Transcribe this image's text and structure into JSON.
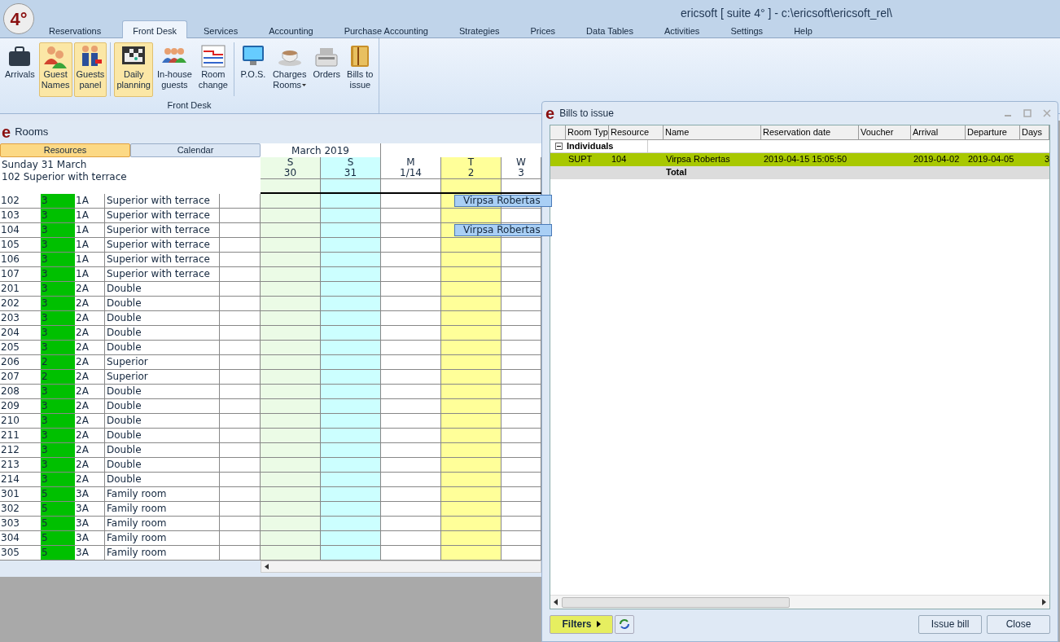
{
  "app": {
    "logo": "4°",
    "title": "ericsoft [ suite 4° ] - c:\\ericsoft\\ericsoft_rel\\"
  },
  "tabs": [
    {
      "label": "Reservations",
      "selected": false
    },
    {
      "label": "Front Desk",
      "selected": true
    },
    {
      "label": "Services",
      "selected": false
    },
    {
      "label": "Accounting",
      "selected": false
    },
    {
      "label": "Purchase Accounting",
      "selected": false
    },
    {
      "label": "Strategies",
      "selected": false
    },
    {
      "label": "Prices",
      "selected": false
    },
    {
      "label": "Data Tables",
      "selected": false
    },
    {
      "label": "Activities",
      "selected": false
    },
    {
      "label": "Settings",
      "selected": false
    },
    {
      "label": "Help",
      "selected": false
    }
  ],
  "ribbon": {
    "group_label": "Front Desk",
    "items": [
      {
        "lines": [
          "Arrivals"
        ],
        "active": false,
        "dropdown": false,
        "separator_before": false
      },
      {
        "lines": [
          "Guest",
          "Names"
        ],
        "active": true,
        "dropdown": false,
        "separator_before": false
      },
      {
        "lines": [
          "Guests",
          "panel"
        ],
        "active": true,
        "dropdown": false,
        "separator_before": false
      },
      {
        "lines": [
          "Daily",
          "planning"
        ],
        "active": true,
        "dropdown": false,
        "separator_before": true
      },
      {
        "lines": [
          "In-house",
          "guests"
        ],
        "active": false,
        "dropdown": false,
        "separator_before": false
      },
      {
        "lines": [
          "Room",
          "change"
        ],
        "active": false,
        "dropdown": false,
        "separator_before": false
      },
      {
        "lines": [
          "P.O.S."
        ],
        "active": false,
        "dropdown": false,
        "separator_before": true
      },
      {
        "lines": [
          "Charges",
          "Rooms"
        ],
        "active": false,
        "dropdown": true,
        "separator_before": false
      },
      {
        "lines": [
          "Orders"
        ],
        "active": false,
        "dropdown": false,
        "separator_before": false
      },
      {
        "lines": [
          "Bills to",
          "issue"
        ],
        "active": false,
        "dropdown": false,
        "separator_before": false
      }
    ]
  },
  "rooms": {
    "logo": "e",
    "title": "Rooms",
    "view_tabs": [
      {
        "label": "Resources",
        "selected": true
      },
      {
        "label": "Calendar",
        "selected": false
      }
    ],
    "date_line": "Sunday 31 March",
    "room_line": "102 Superior with terrace",
    "month": "March 2019",
    "days": [
      {
        "weekday": "S",
        "day": "30",
        "color": "#ebfbe6"
      },
      {
        "weekday": "S",
        "day": "31",
        "color": "#ccffff"
      },
      {
        "weekday": "M",
        "day": "1/14",
        "color": "#ffffff"
      },
      {
        "weekday": "T",
        "day": "2",
        "color": "#ffff99"
      },
      {
        "weekday": "W",
        "day": "3",
        "color": "#ffffff"
      }
    ],
    "rows": [
      {
        "room": "102",
        "capacity": "3",
        "code": "1A",
        "type": "Superior with terrace",
        "booking": "Virpsa Robertas"
      },
      {
        "room": "103",
        "capacity": "3",
        "code": "1A",
        "type": "Superior with terrace"
      },
      {
        "room": "104",
        "capacity": "3",
        "code": "1A",
        "type": "Superior with terrace",
        "booking": "Virpsa Robertas"
      },
      {
        "room": "105",
        "capacity": "3",
        "code": "1A",
        "type": "Superior with terrace"
      },
      {
        "room": "106",
        "capacity": "3",
        "code": "1A",
        "type": "Superior with terrace"
      },
      {
        "room": "107",
        "capacity": "3",
        "code": "1A",
        "type": "Superior with terrace"
      },
      {
        "room": "201",
        "capacity": "3",
        "code": "2A",
        "type": "Double"
      },
      {
        "room": "202",
        "capacity": "3",
        "code": "2A",
        "type": "Double"
      },
      {
        "room": "203",
        "capacity": "3",
        "code": "2A",
        "type": "Double"
      },
      {
        "room": "204",
        "capacity": "3",
        "code": "2A",
        "type": "Double"
      },
      {
        "room": "205",
        "capacity": "3",
        "code": "2A",
        "type": "Double"
      },
      {
        "room": "206",
        "capacity": "2",
        "code": "2A",
        "type": "Superior"
      },
      {
        "room": "207",
        "capacity": "2",
        "code": "2A",
        "type": "Superior"
      },
      {
        "room": "208",
        "capacity": "3",
        "code": "2A",
        "type": "Double"
      },
      {
        "room": "209",
        "capacity": "3",
        "code": "2A",
        "type": "Double"
      },
      {
        "room": "210",
        "capacity": "3",
        "code": "2A",
        "type": "Double"
      },
      {
        "room": "211",
        "capacity": "3",
        "code": "2A",
        "type": "Double"
      },
      {
        "room": "212",
        "capacity": "3",
        "code": "2A",
        "type": "Double"
      },
      {
        "room": "213",
        "capacity": "3",
        "code": "2A",
        "type": "Double"
      },
      {
        "room": "214",
        "capacity": "3",
        "code": "2A",
        "type": "Double"
      },
      {
        "room": "301",
        "capacity": "5",
        "code": "3A",
        "type": "Family room"
      },
      {
        "room": "302",
        "capacity": "5",
        "code": "3A",
        "type": "Family room"
      },
      {
        "room": "303",
        "capacity": "5",
        "code": "3A",
        "type": "Family room"
      },
      {
        "room": "304",
        "capacity": "5",
        "code": "3A",
        "type": "Family room"
      },
      {
        "room": "305",
        "capacity": "5",
        "code": "3A",
        "type": "Family room"
      }
    ]
  },
  "dialog": {
    "logo": "e",
    "title": "Bills to issue",
    "columns": [
      "Room Typ",
      "Resource",
      "Name",
      "Reservation date",
      "Voucher",
      "Arrival",
      "Departure",
      "Days"
    ],
    "group": {
      "label": "Individuals",
      "expanded": true
    },
    "rows": [
      {
        "selected": true,
        "cells": [
          "SUPT",
          "104",
          "Virpsa Robertas",
          "2019-04-15 15:05:50",
          "",
          "2019-04-02",
          "2019-04-05",
          "3"
        ]
      }
    ],
    "total_label": "Total",
    "filters_button": "Filters",
    "buttons": [
      "Issue bill",
      "Close"
    ]
  }
}
